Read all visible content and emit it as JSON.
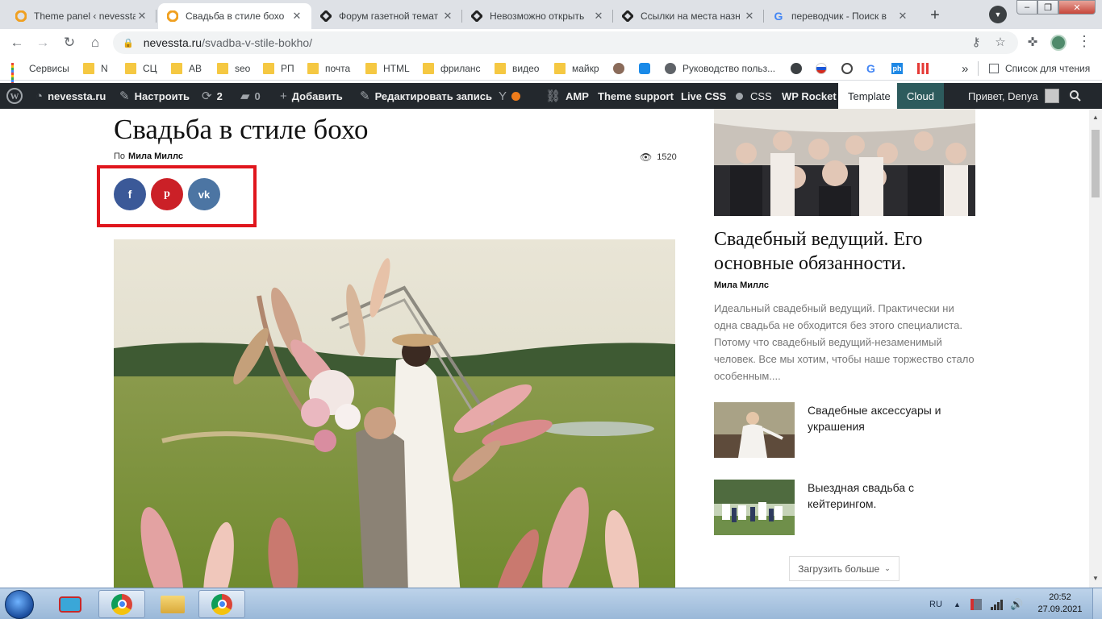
{
  "browser": {
    "tabs": [
      {
        "title": "Theme panel ‹ nevessta",
        "icon": "wp-orange-icon"
      },
      {
        "title": "Свадьба в стиле бохо",
        "icon": "wp-orange-icon",
        "active": true
      },
      {
        "title": "Форум газетной темат",
        "icon": "diamond-logo-icon"
      },
      {
        "title": "Невозможно открыть",
        "icon": "diamond-logo-icon"
      },
      {
        "title": "Ссылки на места назн",
        "icon": "diamond-logo-icon"
      },
      {
        "title": "переводчик - Поиск в",
        "icon": "google-g-icon"
      }
    ],
    "tab_close": "✕",
    "new_tab": "+",
    "address": {
      "host": "nevessta.ru",
      "path": "/svadba-v-stile-bokho/"
    },
    "bookmarks": [
      {
        "label": "Сервисы",
        "icon": "apps-grid-icon"
      },
      {
        "label": "N",
        "icon": "folder-icon"
      },
      {
        "label": "СЦ",
        "icon": "folder-icon"
      },
      {
        "label": "AB",
        "icon": "folder-icon"
      },
      {
        "label": "seo",
        "icon": "folder-icon"
      },
      {
        "label": "РП",
        "icon": "folder-icon"
      },
      {
        "label": "почта",
        "icon": "folder-icon"
      },
      {
        "label": "HTML",
        "icon": "folder-icon"
      },
      {
        "label": "фриланс",
        "icon": "folder-icon"
      },
      {
        "label": "видео",
        "icon": "folder-icon"
      },
      {
        "label": "майкр",
        "icon": "folder-icon"
      },
      {
        "label": "Руководство польз...",
        "icon": "globe-icon"
      }
    ],
    "more_bookmarks": "»",
    "reading_list": "Список для чтения"
  },
  "wp_admin_bar": {
    "site": "nevessta.ru",
    "customize": "Настроить",
    "updates": "2",
    "comments": "0",
    "add_new": "Добавить",
    "edit_post": "Редактировать запись",
    "amp": "AMP",
    "theme_support": "Theme support",
    "live_css": "Live CSS",
    "css": "CSS",
    "wp_rocket": "WP Rocket",
    "template": "Template",
    "cloud": "Cloud",
    "greeting": "Привет, Denya"
  },
  "post": {
    "title": "Свадьба в стиле бохо",
    "by": "По",
    "author": "Мила Миллс",
    "views": "1520",
    "share": [
      "f",
      "p",
      "vk"
    ],
    "colors": {
      "facebook": "#3b5998",
      "pinterest": "#cb2027",
      "vk": "#4c75a3",
      "highlight": "#e0161d"
    }
  },
  "sidebar": {
    "featured": {
      "title": "Свадебный ведущий. Его основные обязанности.",
      "author": "Мила Миллс",
      "excerpt": "Идеальный свадебный ведущий. Практически ни одна свадьба не обходится без этого специалиста. Потому что свадебный ведущий-незаменимый человек. Все мы хотим, чтобы наше торжество стало особенным...."
    },
    "items": [
      {
        "title": "Свадебные аксессуары и украшения"
      },
      {
        "title": "Выездная свадьба с кейтерингом."
      }
    ],
    "load_more": "Загрузить больше"
  },
  "taskbar": {
    "lang": "RU",
    "time": "20:52",
    "date": "27.09.2021"
  }
}
